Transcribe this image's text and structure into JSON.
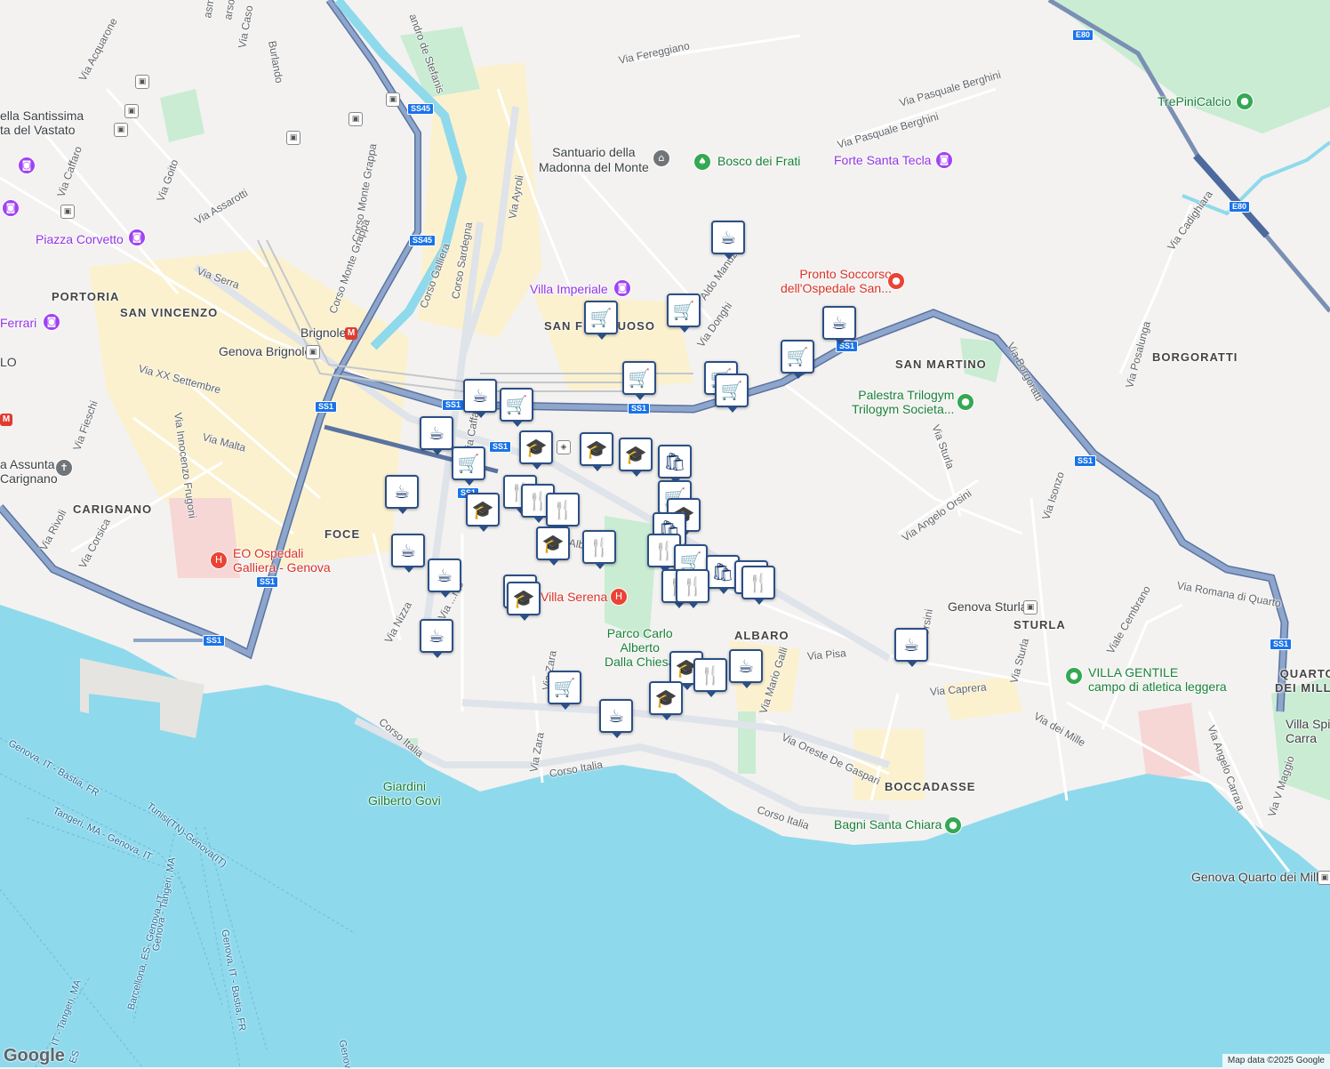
{
  "colors": {
    "sea": "#8fd9ec",
    "land": "#f3f2f0",
    "park": "#c9ecd3",
    "highway": "#7b95bd",
    "highway_border": "#5a73a0",
    "main_road": "#ffffff",
    "urban": "#fbf1cf",
    "marker_border": "#2b4f86"
  },
  "districts": {
    "portoria": "PORTORIA",
    "san_vincenzo": "SAN VINCENZO",
    "carignano": "CARIGNANO",
    "foce": "FOCE",
    "san_fruttuoso": "SAN FRUTTUOSO",
    "albaro": "ALBARO",
    "san_martino": "SAN MARTINO",
    "borgoratti": "BORGORATTI",
    "sturla": "STURLA",
    "boccadasse": "BOCCADASSE",
    "quarto": "QUARTO\nDEI MILLE"
  },
  "streets": {
    "via_acquarone": "Via Acquarone",
    "via_caffaro": "Via Caffaro",
    "via_goito": "Via Goito",
    "via_assarotti": "Via Assarotti",
    "corso_monte_grappa": "Corso Monte Grappa",
    "corso_monte_grappa2": "Corso Monte Grappa",
    "via_serra": "Via Serra",
    "via_xx": "Via XX Settembre",
    "via_fieschi": "Via Fieschi",
    "via_malta": "Via Malta",
    "via_innocenzo": "Via Innocenzo Frugoni",
    "via_rivoli": "Via Rivoli",
    "via_corsica": "Via Corsica",
    "corso_galliera": "Corso Galliera",
    "corso_sardegna": "Corso Sardegna",
    "via_ayroli": "Via Ayroli",
    "alessandro": "andro de Stefanis",
    "via_fereggiano": "Via Fereggiano",
    "via_berghini1": "Via Pasquale Berghini",
    "via_berghini2": "Via Pasquale Berghini",
    "aldo_manuzio": "Aldo Manuzio",
    "via_donghi": "Via Donghi",
    "via_borgoratti": "Via Borgoratti",
    "via_posalunga": "Via Posalunga",
    "via_cadighiara": "Via Cadighiara",
    "via_sturla": "Via Sturla",
    "via_angelo_orsini": "Via Angelo Orsini",
    "via_isonzo": "Via Isonzo",
    "via_romana": "Via Romana di Quarto",
    "viale_cembrano": "Viale Cembrano",
    "via_sturla2": "Via Sturla",
    "via_caprera": "Via Caprera",
    "via_pisa": "Via Pisa",
    "via_mario_galli": "Via Mario Galli",
    "via_oreste": "Via Oreste De Gaspari",
    "via_del_mille": "Via dei Mille",
    "via_angelo_carrara": "Via Angelo Carrara",
    "via_v_maggio": "Via V Maggio",
    "corso_italia1": "Corso Italia",
    "corso_italia2": "Corso Italia",
    "corso_italia3": "Corso Italia",
    "via_nizza": "Via Nizza",
    "via_zara": "Via Zara",
    "via_zara2": "Via Zara",
    "via_orsini_v": "Via Orsini",
    "via_caffa": "Via Caffa",
    "via_albaro": "Alb",
    "via_casa": "Via Caso",
    "via_burlando": "Burlando",
    "via_carso": "arso",
    "via_masno": "asmo",
    "via_nto": "Via ...nto"
  },
  "pois": {
    "santissima": "ella Santissima\nta del Vastato",
    "piazza_corvetto": "Piazza Corvetto",
    "ferrari": "Ferrari",
    "lo": "LO",
    "assunta": "a Assunta\nCarignano",
    "ospedale_galliera": "EO Ospedali\nGalliera - Genova",
    "villa_imperiale": "Villa Imperiale",
    "santuario": "Santuario della\nMadonna del Monte",
    "bosco": "Bosco dei Frati",
    "forte": "Forte Santa Tecla",
    "pronto_soccorso": "Pronto Soccorso\ndell'Ospedale San...",
    "trepini": "TrePiniCalcio",
    "palestra": "Palestra Trilogym\nTrilogym Societa...",
    "brignole": "Brignole",
    "genova_brignole": "Genova Brignole",
    "villa_serena": "Villa Serena",
    "parco": "Parco Carlo\nAlberto\nDalla Chiesa",
    "genova_sturla": "Genova Sturla",
    "villa_gentile": "VILLA GENTILE\ncampo di atletica leggera",
    "villa_spi": "Villa Spi\nCarra",
    "giardini": "Giardini\nGilberto Govi",
    "bagni": "Bagni Santa Chiara",
    "quarto_station": "Genova Quarto dei Mille"
  },
  "shields": {
    "ss45a": "SS45",
    "ss45b": "SS45",
    "ss1a": "SS1",
    "ss1b": "SS1",
    "ss1c": "SS1",
    "ss1d": "SS1",
    "ss1e": "SS1",
    "ss1f": "SS1",
    "ss1g": "SS1",
    "ss1h": "SS1",
    "ss1i": "SS1",
    "e80a": "E80",
    "e80b": "E80"
  },
  "sea_routes": {
    "r1": "Genova, IT - Bastia, FR",
    "r2": "Tangeri, MA - Genova, IT",
    "r3": "Tunisi(TN)-Genova(IT)",
    "r4": "Barcellona, ES- Genova, IT",
    "r5": "Genova, IT - Bastia, FR",
    "r6": "Genova - Tangeri, MA",
    "r7": "IT - Tangeri, MA",
    "r8": "ES",
    "r9": "Genov"
  },
  "marker_icons": {
    "cafe": "☕",
    "grocery": "🛒",
    "school": "🎓",
    "restaurant": "🍴",
    "shop": "🛍"
  },
  "attribution": "Map data ©2025 Google",
  "logo": "Google"
}
